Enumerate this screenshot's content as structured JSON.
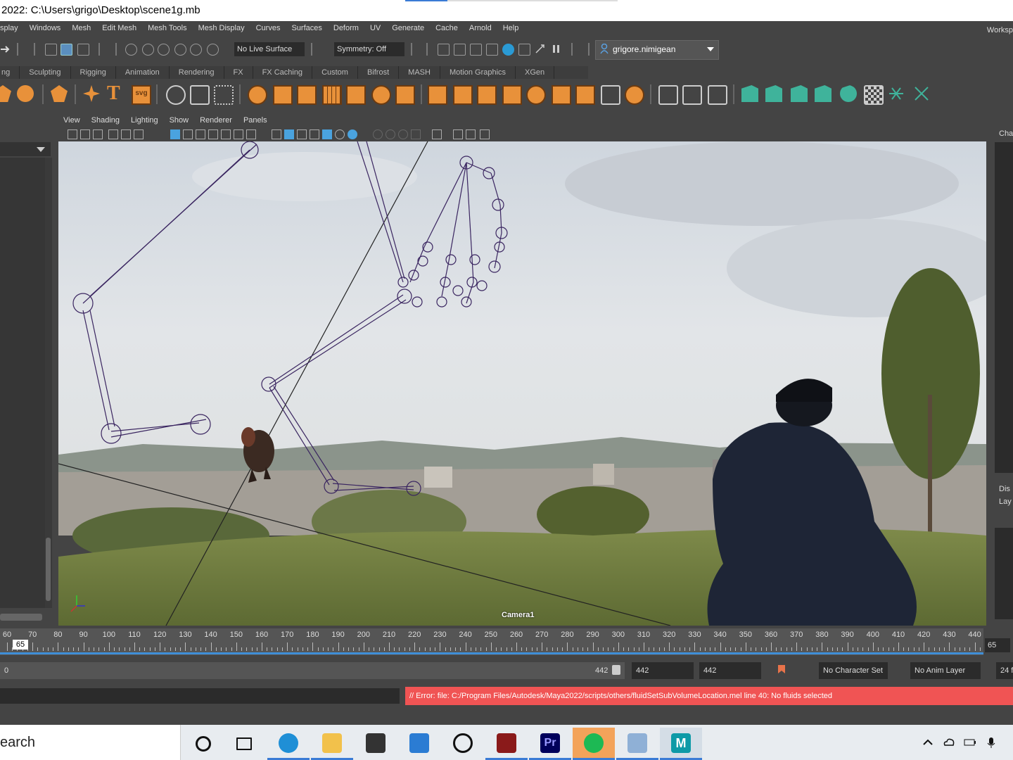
{
  "title_bar": {
    "text": "2022: C:\\Users\\grigo\\Desktop\\scene1g.mb"
  },
  "menu": {
    "items": [
      "splay",
      "Windows",
      "Mesh",
      "Edit Mesh",
      "Mesh Tools",
      "Mesh Display",
      "Curves",
      "Surfaces",
      "Deform",
      "UV",
      "Generate",
      "Cache",
      "Arnold",
      "Help"
    ],
    "workspace": "Worksp"
  },
  "status_line": {
    "live_surface": "No Live Surface",
    "symmetry": "Symmetry: Off",
    "user": "grigore.nimigean"
  },
  "shelf_tabs": [
    "ng",
    "Sculpting",
    "Rigging",
    "Animation",
    "Rendering",
    "FX",
    "FX Caching",
    "Custom",
    "Bifrost",
    "MASH",
    "Motion Graphics",
    "XGen"
  ],
  "shelf_icons": {
    "polygon_group": [
      "polygon-diamond-icon",
      "polygon-sphere-icon",
      "polygon-icosahedron-icon",
      "star-icon",
      "type-icon",
      "svg-icon"
    ],
    "svg_label": "svg",
    "type_label": "T"
  },
  "panel_menu": [
    "View",
    "Shading",
    "Lighting",
    "Show",
    "Renderer",
    "Panels"
  ],
  "viewport": {
    "camera_label": "Camera1",
    "colors": {
      "rig": "#3a2560",
      "sky": "#d9dde3",
      "grass": "#6e7a3d",
      "jacket": "#1e2536"
    }
  },
  "right_panel": {
    "top_label": "Cha",
    "dis_label": "Dis",
    "lay_label": "Lay"
  },
  "timeline": {
    "current_frame": "65",
    "labels": [
      "60",
      "70",
      "80",
      "90",
      "100",
      "110",
      "120",
      "130",
      "140",
      "150",
      "160",
      "170",
      "180",
      "190",
      "200",
      "210",
      "220",
      "230",
      "240",
      "250",
      "260",
      "270",
      "280",
      "290",
      "300",
      "310",
      "320",
      "330",
      "340",
      "350",
      "360",
      "370",
      "380",
      "390",
      "400",
      "410",
      "420",
      "430",
      "440"
    ],
    "end_field": "65"
  },
  "range": {
    "start": "0",
    "slider_end": "442",
    "end1": "442",
    "end2": "442",
    "character_set": "No Character Set",
    "anim_layer": "No Anim Layer",
    "fps": "24 f"
  },
  "command_line": {
    "error": "// Error: file: C:/Program Files/Autodesk/Maya2022/scripts/others/fluidSetSubVolumeLocation.mel line 40: No fluids selected"
  },
  "taskbar": {
    "search_text": "earch",
    "apps": [
      "cortana",
      "task-view",
      "edge",
      "file-explorer",
      "store",
      "mail",
      "xbox",
      "game-app",
      "premiere",
      "spotify",
      "photos",
      "maya"
    ],
    "premiere_label": "Pr",
    "maya_label": "M"
  }
}
